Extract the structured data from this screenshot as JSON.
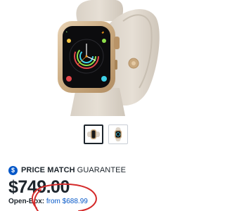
{
  "product": {
    "image_alt_icon": "apple-watch-product-image",
    "thumbnails": [
      {
        "icon": "watch-side-view-thumbnail",
        "selected": true
      },
      {
        "icon": "watch-front-view-thumbnail",
        "selected": false
      }
    ]
  },
  "price_match": {
    "icon_glyph": "$",
    "bold_text": "PRICE MATCH",
    "regular_text": "GUARANTEE"
  },
  "pricing": {
    "price": "$749.00",
    "open_box_label": "Open-Box:",
    "open_box_link": "from $688.99"
  },
  "colors": {
    "accent_blue": "#0457c8",
    "text_dark": "#1d252c",
    "annotation_red": "#d42a2a"
  }
}
